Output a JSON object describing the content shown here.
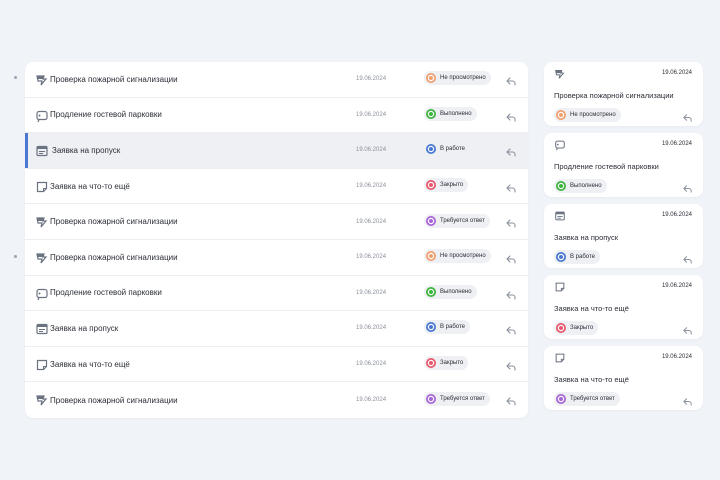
{
  "colors": {
    "not_viewed": "#f0a070",
    "done": "#3fb43f",
    "in_progress": "#4a78d0",
    "closed": "#e8586e",
    "answer_required": "#a865d6",
    "accent": "#4a78d0"
  },
  "list": {
    "rows": [
      {
        "icon": "fire-alarm-icon",
        "title": "Проверка пожарной сигнализации",
        "date": "19.06.2024",
        "status": "Не просмотрено",
        "status_key": "not_viewed"
      },
      {
        "icon": "parking-icon",
        "title": "Продление гостевой парковки",
        "date": "19.06.2024",
        "status": "Выполнено",
        "status_key": "done"
      },
      {
        "icon": "pass-icon",
        "title": "Заявка на пропуск",
        "date": "19.06.2024",
        "status": "В работе",
        "status_key": "in_progress",
        "active": true
      },
      {
        "icon": "note-icon",
        "title": "Заявка на что-то ещё",
        "date": "19.06.2024",
        "status": "Закрыто",
        "status_key": "closed"
      },
      {
        "icon": "fire-alarm-icon",
        "title": "Проверка пожарной сигнализации",
        "date": "19.06.2024",
        "status": "Требуется ответ",
        "status_key": "answer_required"
      },
      {
        "icon": "fire-alarm-icon",
        "title": "Проверка пожарной сигнализации",
        "date": "19.06.2024",
        "status": "Не просмотрено",
        "status_key": "not_viewed"
      },
      {
        "icon": "parking-icon",
        "title": "Продление гостевой парковки",
        "date": "19.06.2024",
        "status": "Выполнено",
        "status_key": "done"
      },
      {
        "icon": "pass-icon",
        "title": "Заявка на пропуск",
        "date": "19.06.2024",
        "status": "В работе",
        "status_key": "in_progress"
      },
      {
        "icon": "note-icon",
        "title": "Заявка на что-то ещё",
        "date": "19.06.2024",
        "status": "Закрыто",
        "status_key": "closed"
      },
      {
        "icon": "fire-alarm-icon",
        "title": "Проверка пожарной сигнализации",
        "date": "19.06.2024",
        "status": "Требуется ответ",
        "status_key": "answer_required"
      }
    ]
  },
  "cards": [
    {
      "icon": "fire-alarm-icon",
      "title": "Проверка пожарной сигнализации",
      "date": "19.06.2024",
      "status": "Не просмотрено",
      "status_key": "not_viewed"
    },
    {
      "icon": "parking-icon",
      "title": "Продление гостевой парковки",
      "date": "19.06.2024",
      "status": "Выполнено",
      "status_key": "done"
    },
    {
      "icon": "pass-icon",
      "title": "Заявка на пропуск",
      "date": "19.06.2024",
      "status": "В работе",
      "status_key": "in_progress"
    },
    {
      "icon": "note-icon",
      "title": "Заявка на что-то ещё",
      "date": "19.06.2024",
      "status": "Закрыто",
      "status_key": "closed"
    },
    {
      "icon": "note-icon",
      "title": "Заявка на что-то ещё",
      "date": "19.06.2024",
      "status": "Требуется ответ",
      "status_key": "answer_required"
    }
  ]
}
